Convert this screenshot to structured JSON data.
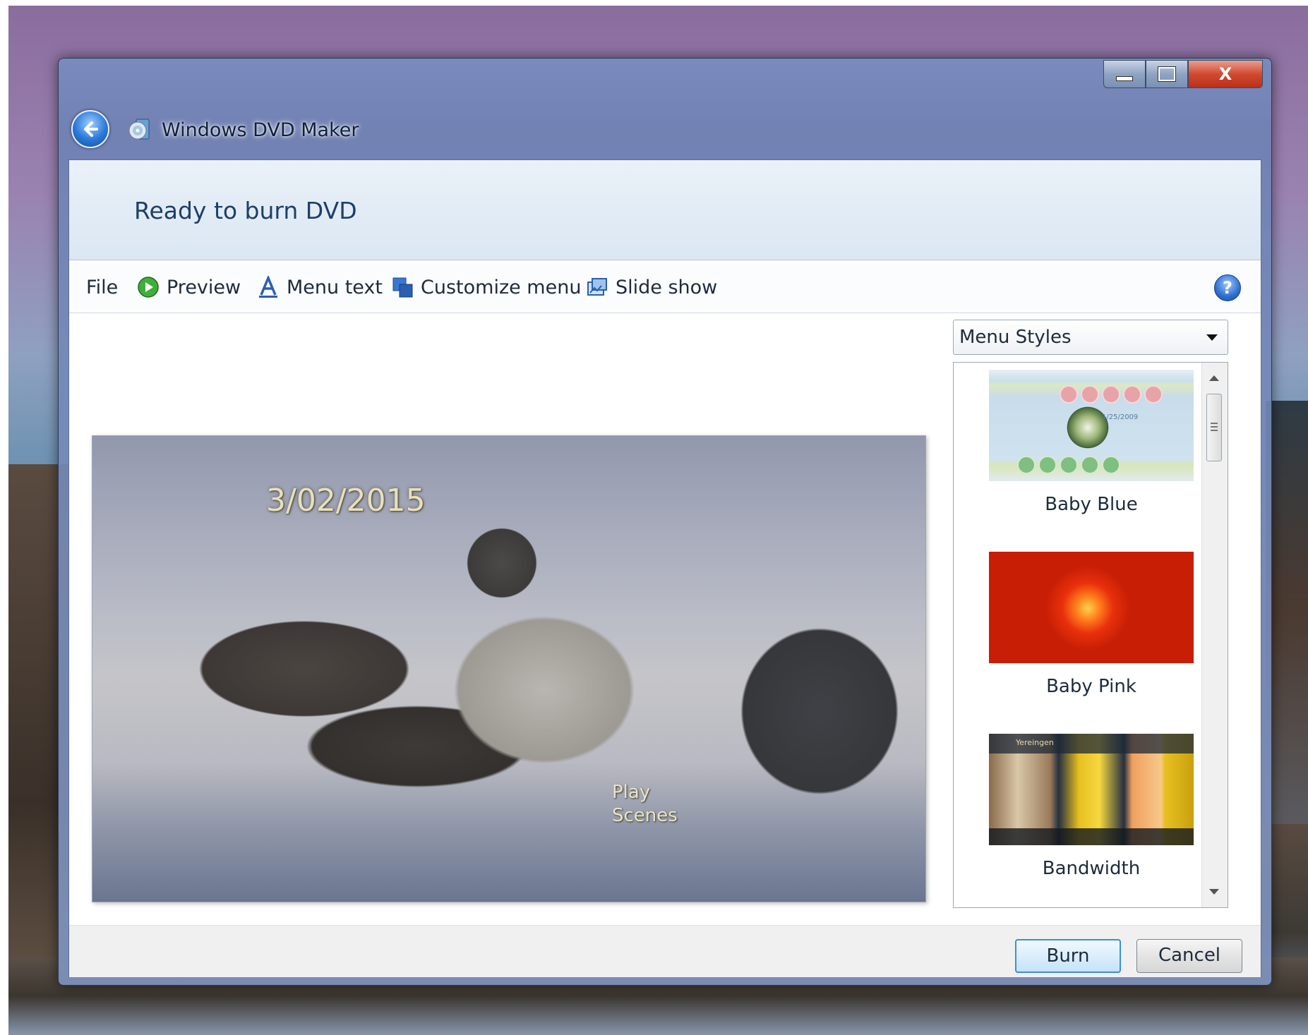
{
  "window": {
    "title": "Windows DVD Maker",
    "close_glyph": "X"
  },
  "page": {
    "heading": "Ready to burn DVD"
  },
  "toolbar": {
    "file": "File",
    "preview": "Preview",
    "menu_text": "Menu text",
    "customize_menu": "Customize menu",
    "slide_show": "Slide show",
    "help_glyph": "?"
  },
  "preview": {
    "date_text": "3/02/2015",
    "play_label": "Play",
    "scenes_label": "Scenes"
  },
  "styles": {
    "dropdown_value": "Menu Styles",
    "items": [
      {
        "name": "Baby Blue",
        "thumb_date": "1/25/2009"
      },
      {
        "name": "Baby Pink"
      },
      {
        "name": "Bandwidth",
        "thumb_text": "Yereingen"
      }
    ]
  },
  "buttons": {
    "burn": "Burn",
    "cancel": "Cancel"
  },
  "colors": {
    "accent": "#3c8fd4",
    "title_text": "#1e3f6a",
    "close_button": "#d04a30"
  }
}
